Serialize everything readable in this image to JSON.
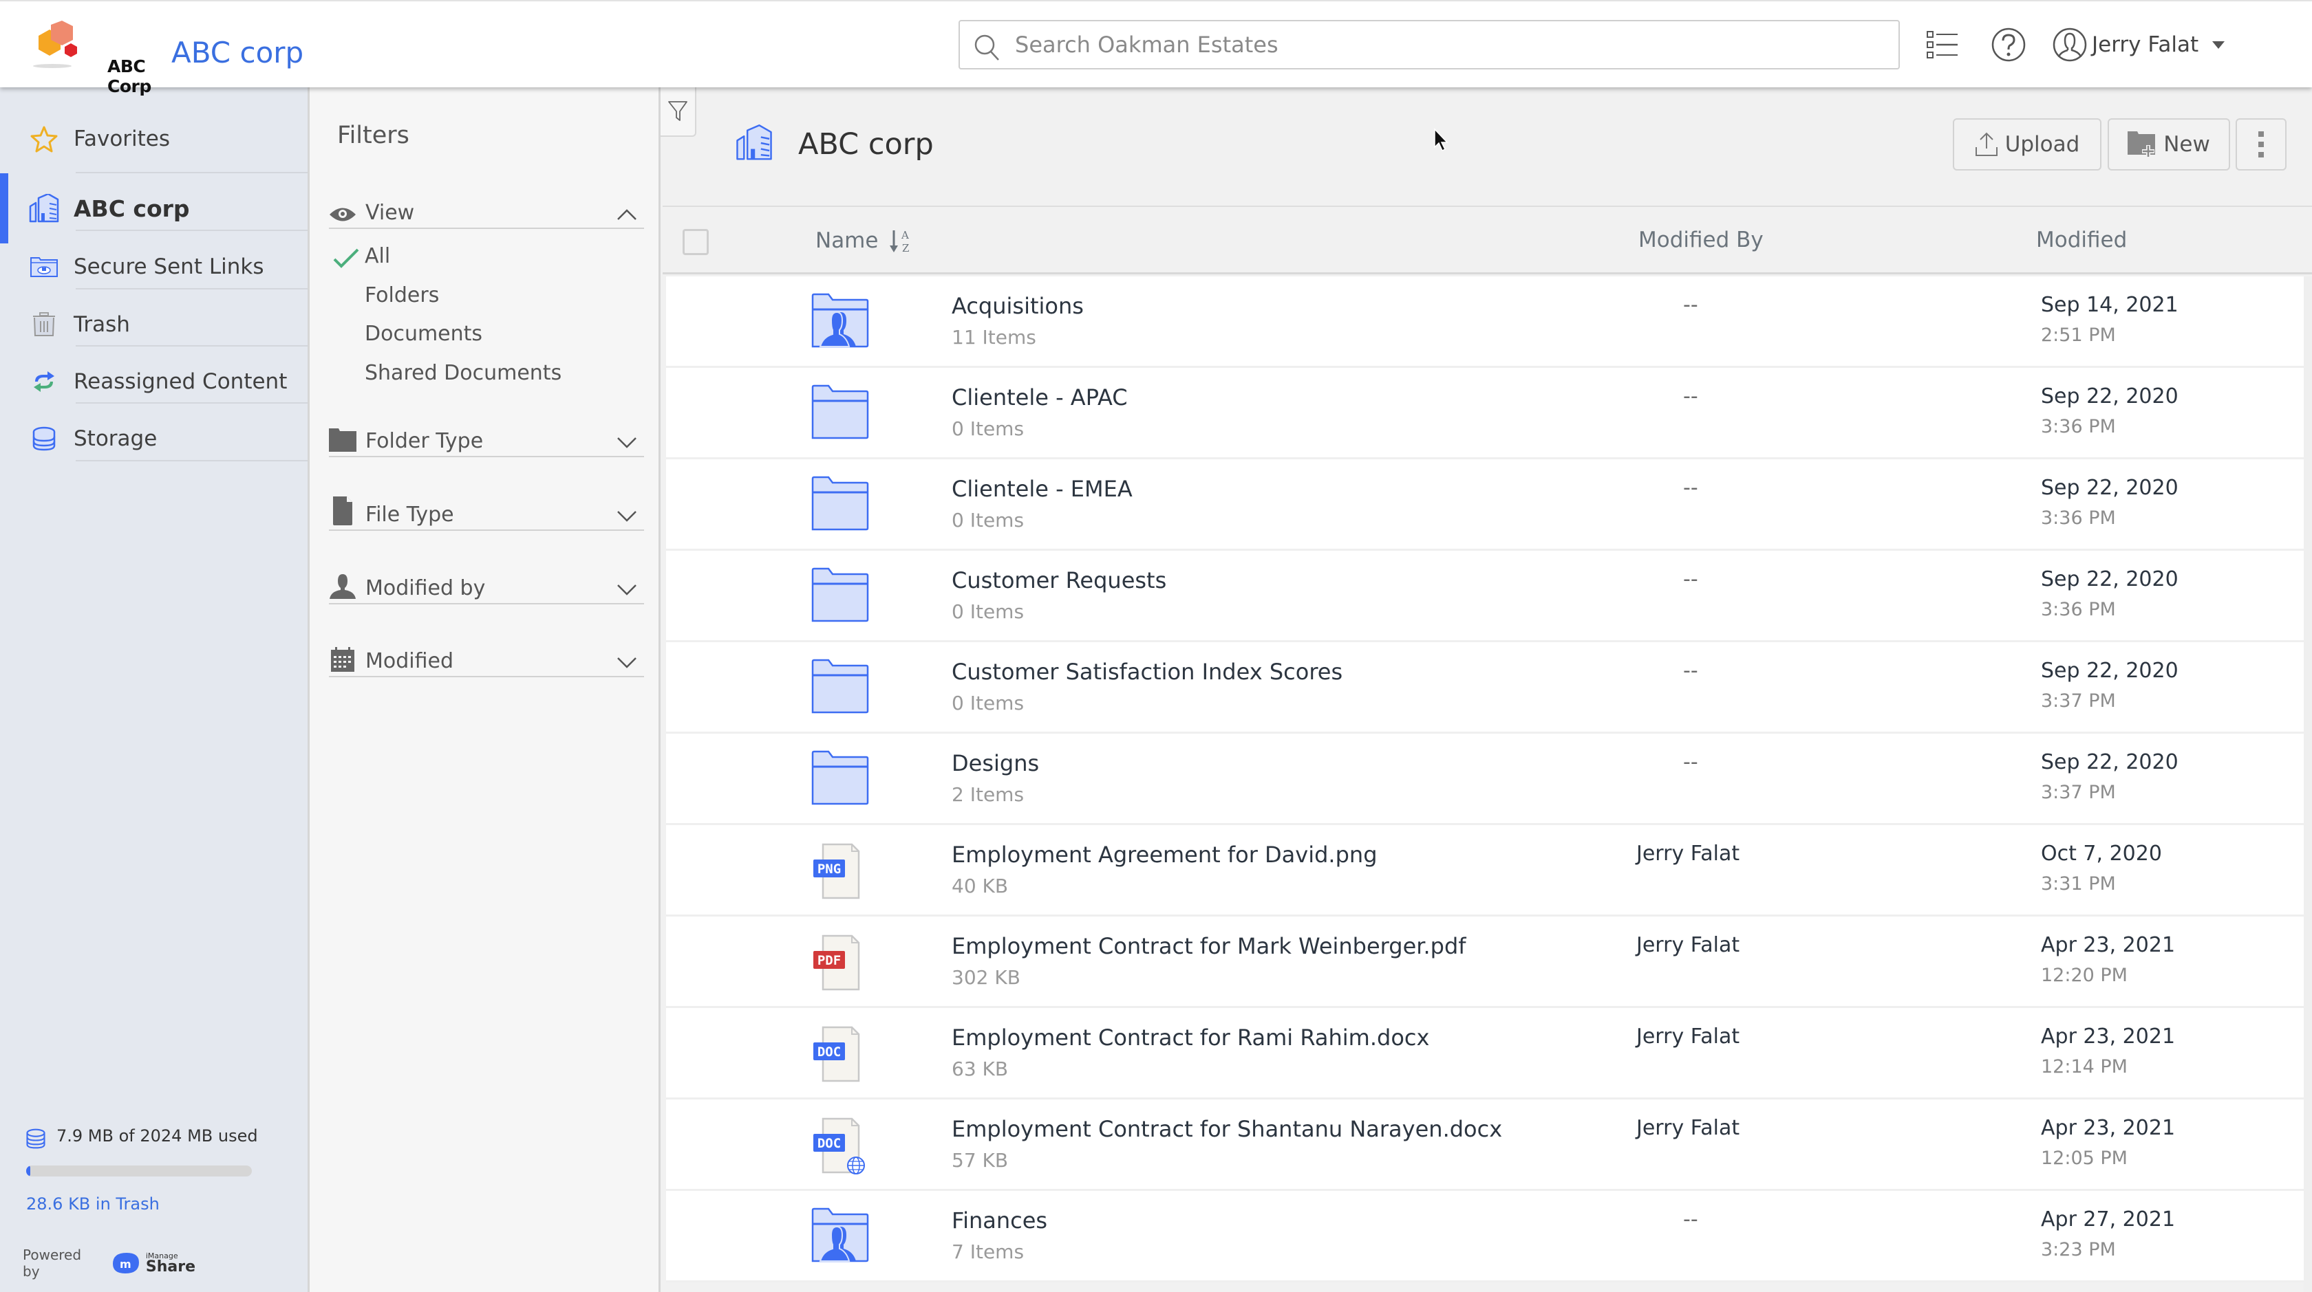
{
  "topbar": {
    "logo_text": "ABC Corp",
    "app_title": "ABC corp",
    "search_placeholder": "Search Oakman Estates",
    "search_value": "",
    "list_view_icon": "list-view-icon",
    "help_icon": "help-icon",
    "user_name": "Jerry Falat"
  },
  "sidebar": {
    "items": [
      {
        "label": "Favorites",
        "icon": "star-icon",
        "active": false
      },
      {
        "label": "ABC corp",
        "icon": "building-icon",
        "active": true
      },
      {
        "label": "Secure Sent Links",
        "icon": "secure-folder-icon",
        "active": false
      },
      {
        "label": "Trash",
        "icon": "trash-icon",
        "active": false
      },
      {
        "label": "Reassigned Content",
        "icon": "reassign-icon",
        "active": false
      },
      {
        "label": "Storage",
        "icon": "database-icon",
        "active": false
      }
    ],
    "storage": {
      "used_text": "7.9 MB of 2024 MB used",
      "used_fraction": 0.0039,
      "trash_text": "28.6 KB in Trash"
    },
    "powered_by": "Powered by",
    "brand_small": "iManage",
    "brand_big": "Share"
  },
  "filters": {
    "title": "Filters",
    "sections": [
      {
        "label": "View",
        "icon": "eye-icon",
        "expanded": true,
        "options": [
          {
            "label": "All",
            "selected": true
          },
          {
            "label": "Folders",
            "selected": false
          },
          {
            "label": "Documents",
            "selected": false
          },
          {
            "label": "Shared Documents",
            "selected": false
          }
        ]
      },
      {
        "label": "Folder Type",
        "icon": "folder-icon",
        "expanded": false
      },
      {
        "label": "File Type",
        "icon": "file-icon",
        "expanded": false
      },
      {
        "label": "Modified by",
        "icon": "person-icon",
        "expanded": false
      },
      {
        "label": "Modified",
        "icon": "calendar-icon",
        "expanded": false
      }
    ]
  },
  "main": {
    "title": "ABC corp",
    "buttons": {
      "upload": "Upload",
      "new": "New"
    },
    "columns": {
      "name": "Name",
      "modified_by": "Modified By",
      "modified": "Modified"
    },
    "rows": [
      {
        "name": "Acquisitions",
        "sub": "11 Items",
        "type": "shared-folder",
        "modified_by": "--",
        "date": "Sep 14, 2021",
        "time": "2:51 PM"
      },
      {
        "name": "Clientele - APAC",
        "sub": "0 Items",
        "type": "folder",
        "modified_by": "--",
        "date": "Sep 22, 2020",
        "time": "3:36 PM"
      },
      {
        "name": "Clientele - EMEA",
        "sub": "0 Items",
        "type": "folder",
        "modified_by": "--",
        "date": "Sep 22, 2020",
        "time": "3:36 PM"
      },
      {
        "name": "Customer Requests",
        "sub": "0 Items",
        "type": "folder",
        "modified_by": "--",
        "date": "Sep 22, 2020",
        "time": "3:36 PM"
      },
      {
        "name": "Customer Satisfaction Index Scores",
        "sub": "0 Items",
        "type": "folder",
        "modified_by": "--",
        "date": "Sep 22, 2020",
        "time": "3:37 PM"
      },
      {
        "name": "Designs",
        "sub": "2 Items",
        "type": "folder",
        "modified_by": "--",
        "date": "Sep 22, 2020",
        "time": "3:37 PM"
      },
      {
        "name": "Employment Agreement for David.png",
        "sub": "40 KB",
        "type": "png",
        "badge": "PNG",
        "modified_by": "Jerry Falat",
        "date": "Oct 7, 2020",
        "time": "3:31 PM"
      },
      {
        "name": "Employment Contract for Mark Weinberger.pdf",
        "sub": "302 KB",
        "type": "pdf",
        "badge": "PDF",
        "modified_by": "Jerry Falat",
        "date": "Apr 23, 2021",
        "time": "12:20 PM"
      },
      {
        "name": "Employment Contract for Rami Rahim.docx",
        "sub": "63 KB",
        "type": "doc",
        "badge": "DOC",
        "modified_by": "Jerry Falat",
        "date": "Apr 23, 2021",
        "time": "12:14 PM"
      },
      {
        "name": "Employment Contract for Shantanu Narayen.docx",
        "sub": "57 KB",
        "type": "doc-shared",
        "badge": "DOC",
        "modified_by": "Jerry Falat",
        "date": "Apr 23, 2021",
        "time": "12:05 PM"
      },
      {
        "name": "Finances",
        "sub": "7 Items",
        "type": "shared-folder",
        "modified_by": "--",
        "date": "Apr 27, 2021",
        "time": "3:23 PM"
      }
    ]
  },
  "colors": {
    "accent": "#3d6df2",
    "link": "#3a6fe0",
    "check_green": "#4caf7d",
    "pdf_red": "#d23a3a",
    "folder_fill": "#d6e0fb"
  }
}
